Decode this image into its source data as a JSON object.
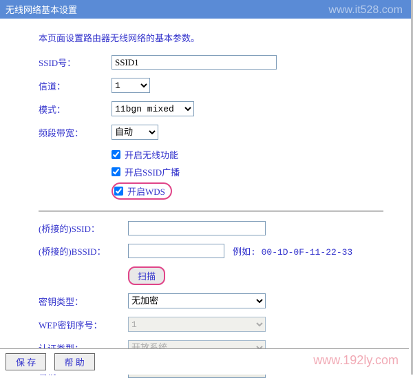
{
  "title": "无线网络基本设置",
  "intro": "本页面设置路由器无线网络的基本参数。",
  "labels": {
    "ssid": "SSID号：",
    "channel": "信道：",
    "mode": "模式：",
    "bandwidth": "频段带宽：",
    "bridged_ssid": "(桥接的)SSID：",
    "bridged_bssid": "(桥接的)BSSID：",
    "key_type": "密钥类型：",
    "wep_index": "WEP密钥序号：",
    "auth_type": "认证类型：",
    "key": "密钥："
  },
  "values": {
    "ssid": "SSID1",
    "channel": "1",
    "mode": "11bgn mixed",
    "bandwidth": "自动",
    "bridged_ssid": "",
    "bridged_bssid": "",
    "key_type": "无加密",
    "wep_index": "1",
    "auth_type": "开放系统",
    "key": ""
  },
  "checkboxes": {
    "enable_wireless": "开启无线功能",
    "enable_ssid_broadcast": "开启SSID广播",
    "enable_wds": "开启WDS"
  },
  "example_text": "例如: 00-1D-0F-11-22-33",
  "buttons": {
    "scan": "扫描",
    "save": "保 存",
    "help": "帮 助"
  },
  "watermarks": {
    "top": "www.it528.com",
    "bottom": "www.192ly.com"
  }
}
